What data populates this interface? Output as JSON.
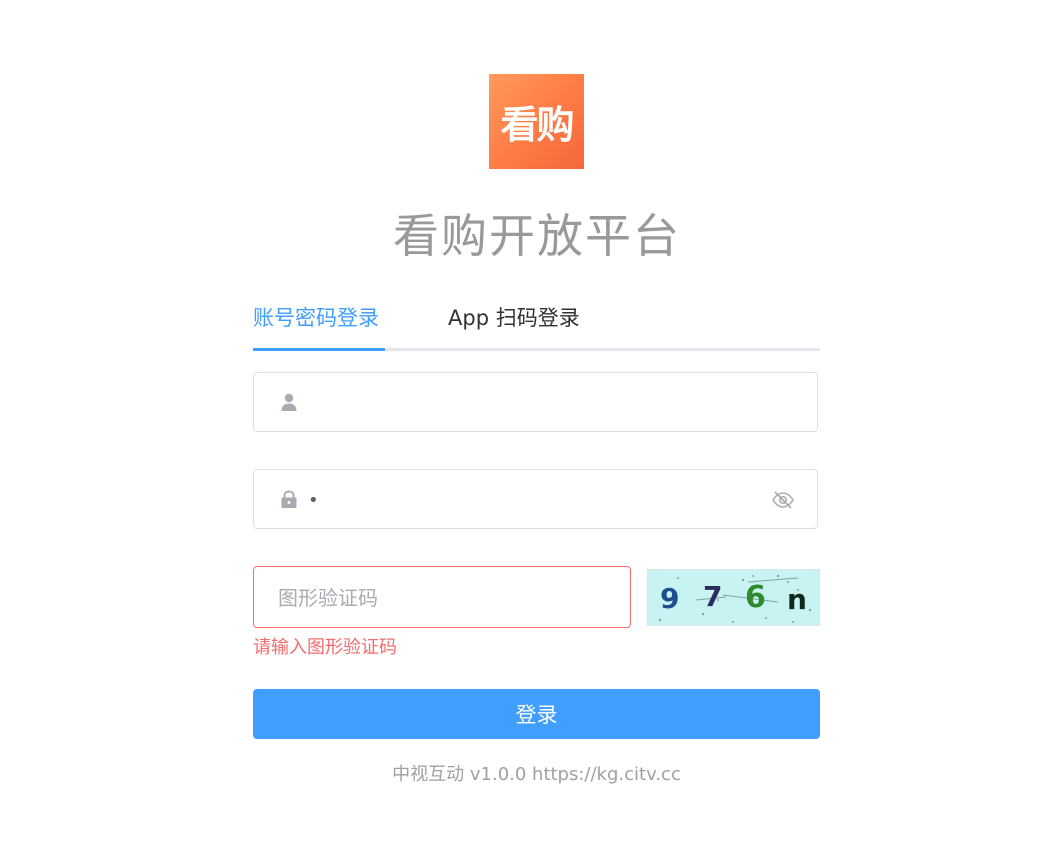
{
  "logo": {
    "text": "看购"
  },
  "page_title": "看购开放平台",
  "tabs": [
    {
      "label": "账号密码登录",
      "active": true
    },
    {
      "label": "App 扫码登录",
      "active": false
    }
  ],
  "form": {
    "username": {
      "value": "",
      "placeholder": "",
      "icon": "user-icon"
    },
    "password": {
      "value": "•",
      "placeholder": "",
      "icon": "lock-icon",
      "toggle_icon": "eye-off-icon"
    },
    "captcha": {
      "value": "",
      "placeholder": "图形验证码",
      "error": "请输入图形验证码"
    },
    "captcha_image": {
      "chars": [
        "9",
        "7",
        "6",
        "n"
      ],
      "char_colors": [
        "#1d4f8f",
        "#2b2b5e",
        "#2f8a2f",
        "#102a1a"
      ],
      "background": "#c7f4f3"
    },
    "submit_label": "登录"
  },
  "footer": "中视互动 v1.0.0 https://kg.citv.cc",
  "colors": {
    "accent": "#409eff",
    "error": "#f56c6c",
    "logo_gradient_start": "#ff9a5c",
    "logo_gradient_end": "#f2683a"
  }
}
